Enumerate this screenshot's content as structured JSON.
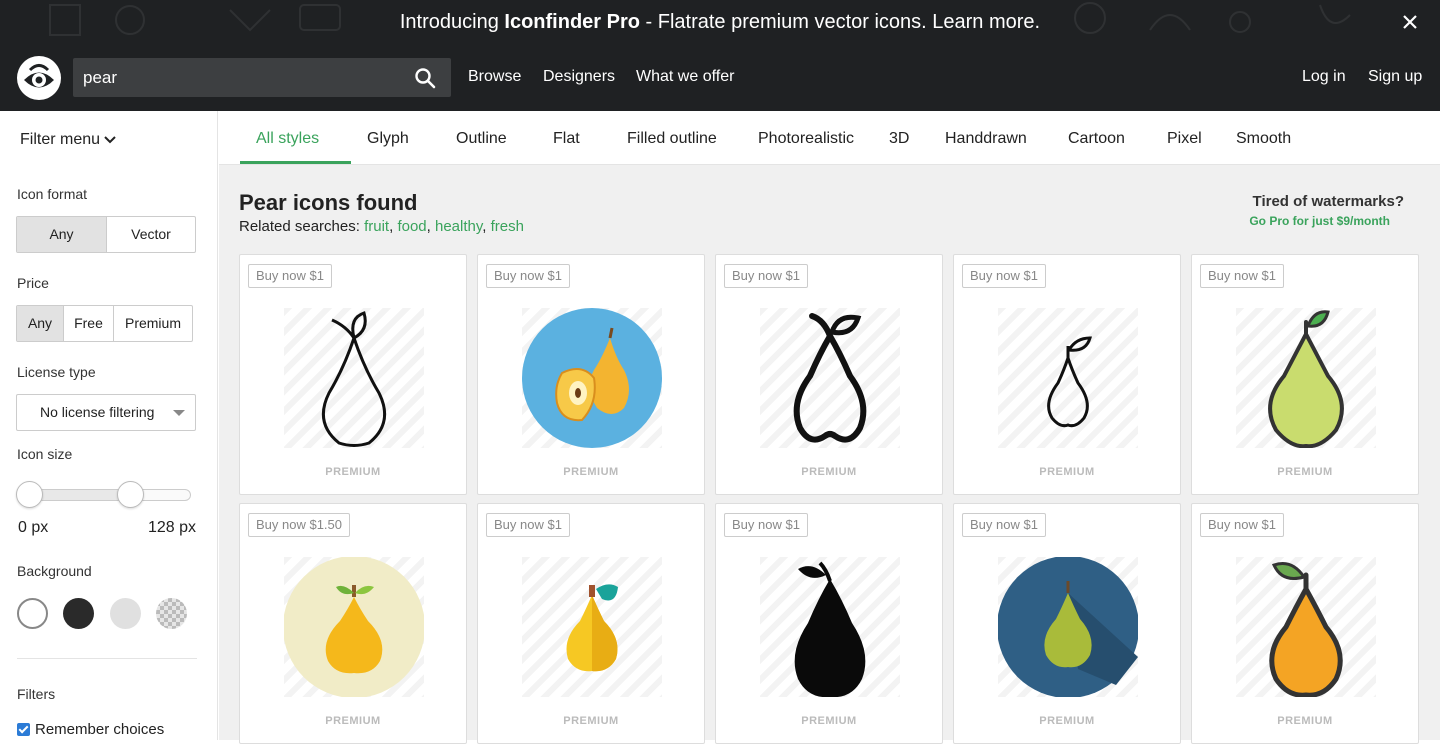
{
  "promo": {
    "text_pre": "Introducing ",
    "brand": "Iconfinder Pro",
    "text_post": " - Flatrate premium vector icons. Learn more."
  },
  "search": {
    "value": "pear"
  },
  "nav": {
    "browse": "Browse",
    "designers": "Designers",
    "offer": "What we offer",
    "login": "Log in",
    "signup": "Sign up"
  },
  "sidebar": {
    "filter_menu": "Filter menu",
    "icon_format": {
      "label": "Icon format",
      "options": [
        "Any",
        "Vector"
      ],
      "selected": "Any"
    },
    "price": {
      "label": "Price",
      "options": [
        "Any",
        "Free",
        "Premium"
      ],
      "selected": "Any"
    },
    "license": {
      "label": "License type",
      "value": "No license filtering"
    },
    "icon_size": {
      "label": "Icon size",
      "min_label": "0 px",
      "max_label": "128 px"
    },
    "background": {
      "label": "Background",
      "swatches": [
        "white",
        "black",
        "light-gray",
        "transparent"
      ]
    },
    "filters": {
      "label": "Filters",
      "remember": "Remember choices",
      "remember_checked": true
    }
  },
  "tabs": [
    "All styles",
    "Glyph",
    "Outline",
    "Flat",
    "Filled outline",
    "Photorealistic",
    "3D",
    "Handdrawn",
    "Cartoon",
    "Pixel",
    "Smooth"
  ],
  "active_tab": "All styles",
  "results": {
    "title": "Pear icons found",
    "related_label": "Related searches:",
    "related": [
      "fruit",
      "food",
      "healthy",
      "fresh"
    ]
  },
  "promo_box": {
    "title": "Tired of watermarks?",
    "link": "Go Pro for just $9/month"
  },
  "icons": [
    {
      "price": "Buy now $1",
      "tag": "PREMIUM",
      "style": "outline-thin"
    },
    {
      "price": "Buy now $1",
      "tag": "PREMIUM",
      "style": "flat-blue-circle"
    },
    {
      "price": "Buy now $1",
      "tag": "PREMIUM",
      "style": "outline-bold"
    },
    {
      "price": "Buy now $1",
      "tag": "PREMIUM",
      "style": "outline-small"
    },
    {
      "price": "Buy now $1",
      "tag": "PREMIUM",
      "style": "filled-outline-green"
    },
    {
      "price": "Buy now $1.50",
      "tag": "PREMIUM",
      "style": "flat-cream-circle"
    },
    {
      "price": "Buy now $1",
      "tag": "PREMIUM",
      "style": "flat-yellow"
    },
    {
      "price": "Buy now $1",
      "tag": "PREMIUM",
      "style": "glyph-black"
    },
    {
      "price": "Buy now $1",
      "tag": "PREMIUM",
      "style": "flat-navy-circle"
    },
    {
      "price": "Buy now $1",
      "tag": "PREMIUM",
      "style": "filled-outline-orange"
    }
  ],
  "colors": {
    "accent": "#3aa35c",
    "topbar": "#1f2123",
    "search_bg": "#3d3f41",
    "main_bg": "#f0f0f0"
  }
}
